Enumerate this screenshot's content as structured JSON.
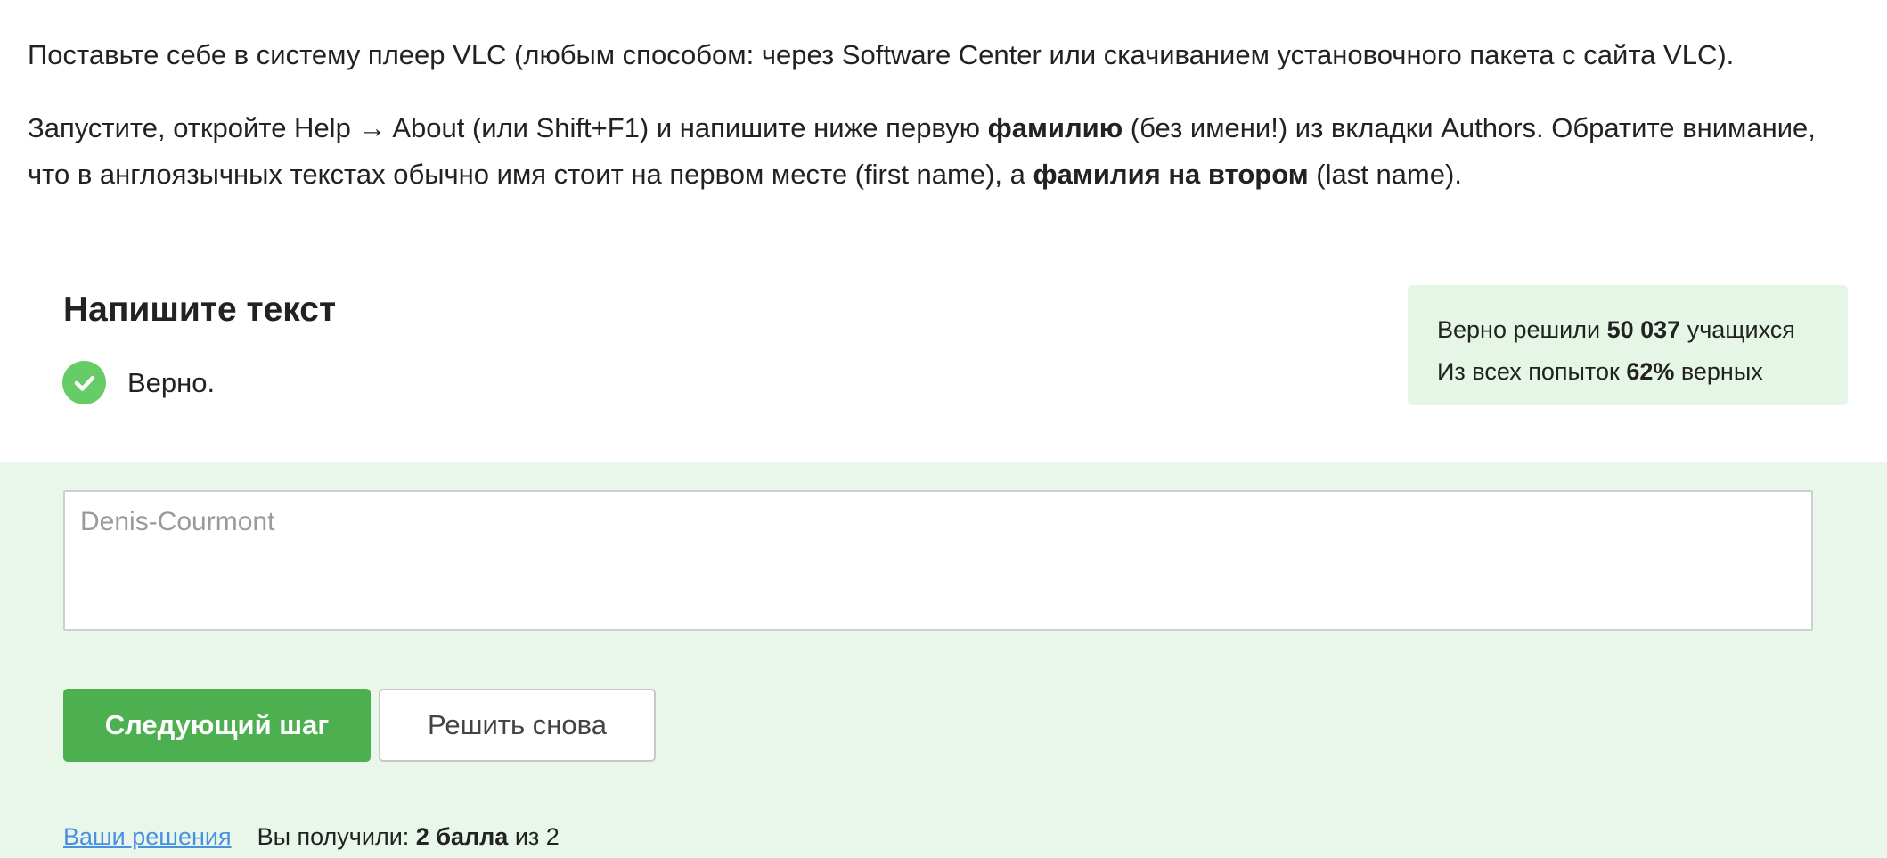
{
  "step": {
    "paragraph1": "Поставьте себе в систему плеер VLC (любым способом: через Software Center или скачиванием установочного пакета с сайта VLC).",
    "paragraph2_a": "Запустите, откройте Help → About (или Shift+F1) и напишите ниже первую ",
    "paragraph2_b": "фамилию",
    "paragraph2_c": " (без имени!) из вкладки Authors. Обратите внимание, что в англоязычных текстах обычно имя стоит на первом месте (first name), а ",
    "paragraph2_d": "фамилия на втором",
    "paragraph2_e": " (last name)."
  },
  "quiz": {
    "title": "Напишите текст",
    "result_label": "Верно.",
    "result_icon": "check-circle-icon"
  },
  "stats": {
    "solved_prefix": "Верно решили ",
    "solved_count": "50 037",
    "solved_suffix": " учащихся",
    "attempts_prefix": "Из всех попыток ",
    "attempts_percent": "62%",
    "attempts_suffix": " верных"
  },
  "answer": {
    "placeholder": "Denis-Courmont"
  },
  "buttons": {
    "next_label": "Следующий шаг",
    "retry_label": "Решить снова"
  },
  "footer": {
    "solutions_link": "Ваши решения",
    "score_prefix": "Вы получили: ",
    "score_value": "2 балла",
    "score_suffix": " из 2"
  },
  "colors": {
    "accent_green": "#4caf50",
    "check_green": "#66cc66",
    "stats_bg": "#e6f6e6",
    "area_bg": "#e9f7ea",
    "link_blue": "#4a8fe0"
  }
}
